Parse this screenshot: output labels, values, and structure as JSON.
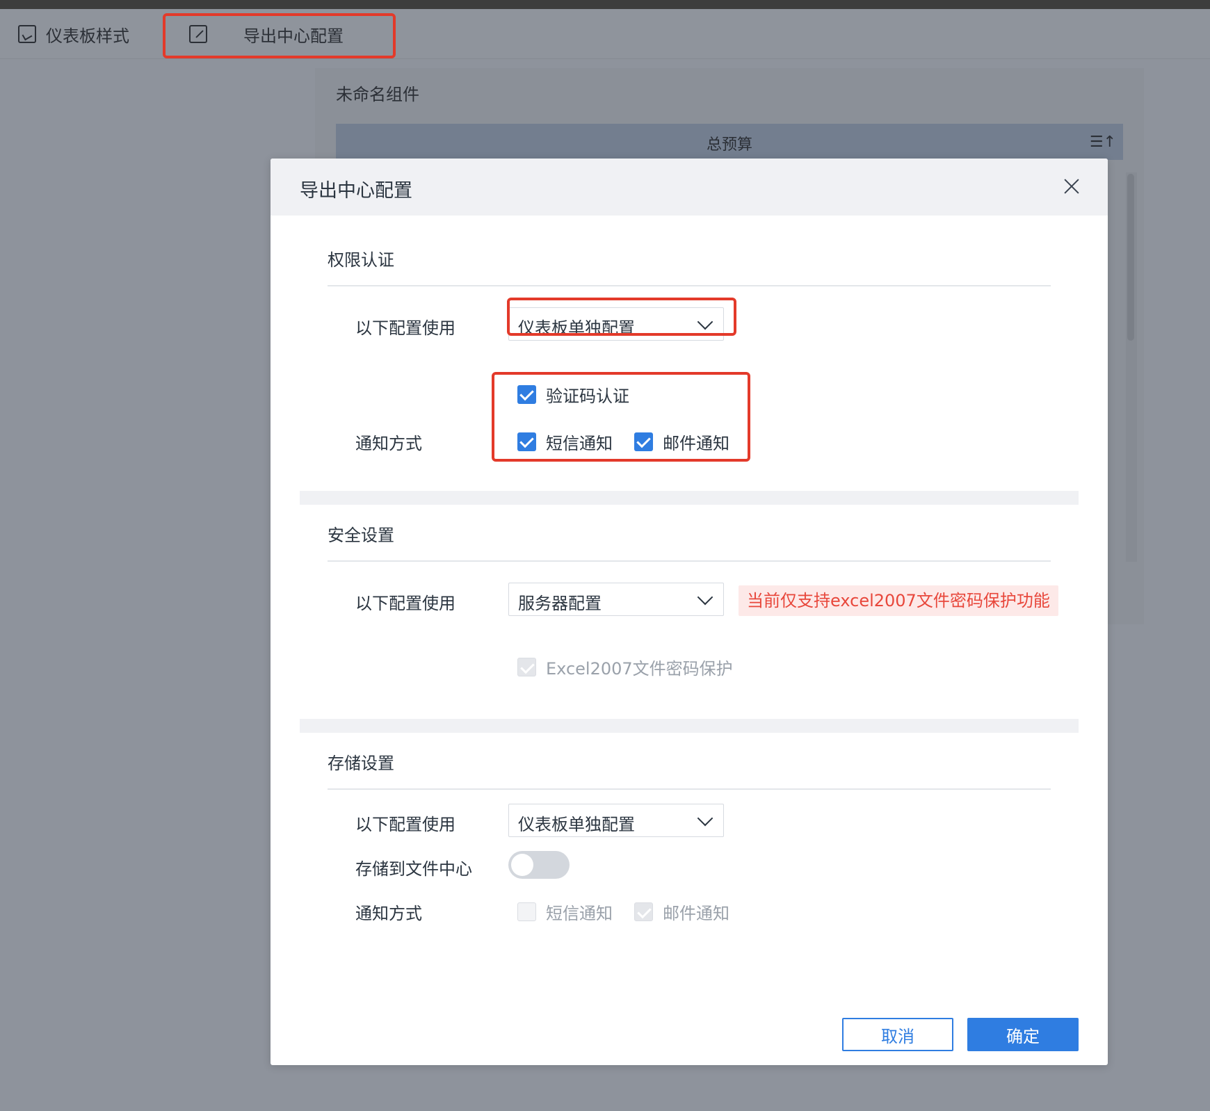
{
  "toolbar": {
    "dashboard_style": "仪表板样式",
    "export_center_config": "导出中心配置"
  },
  "background_panel": {
    "title": "未命名组件",
    "column_header": "总预算"
  },
  "modal": {
    "title": "导出中心配置",
    "permission": {
      "section_title": "权限认证",
      "config_label": "以下配置使用",
      "config_value": "仪表板单独配置",
      "notify_label": "通知方式",
      "captcha": "验证码认证",
      "sms": "短信通知",
      "email": "邮件通知"
    },
    "security": {
      "section_title": "安全设置",
      "config_label": "以下配置使用",
      "config_value": "服务器配置",
      "warning": "当前仅支持excel2007文件密码保护功能",
      "excel_protect": "Excel2007文件密码保护"
    },
    "storage": {
      "section_title": "存储设置",
      "config_label": "以下配置使用",
      "config_value": "仪表板单独配置",
      "save_label": "存储到文件中心",
      "notify_label": "通知方式",
      "sms": "短信通知",
      "email": "邮件通知"
    },
    "buttons": {
      "cancel": "取消",
      "confirm": "确定"
    }
  },
  "colors": {
    "primary": "#2f7de1",
    "highlight": "#e33a2a",
    "warning_text": "#e8473b",
    "warning_bg": "#fde9e8"
  }
}
